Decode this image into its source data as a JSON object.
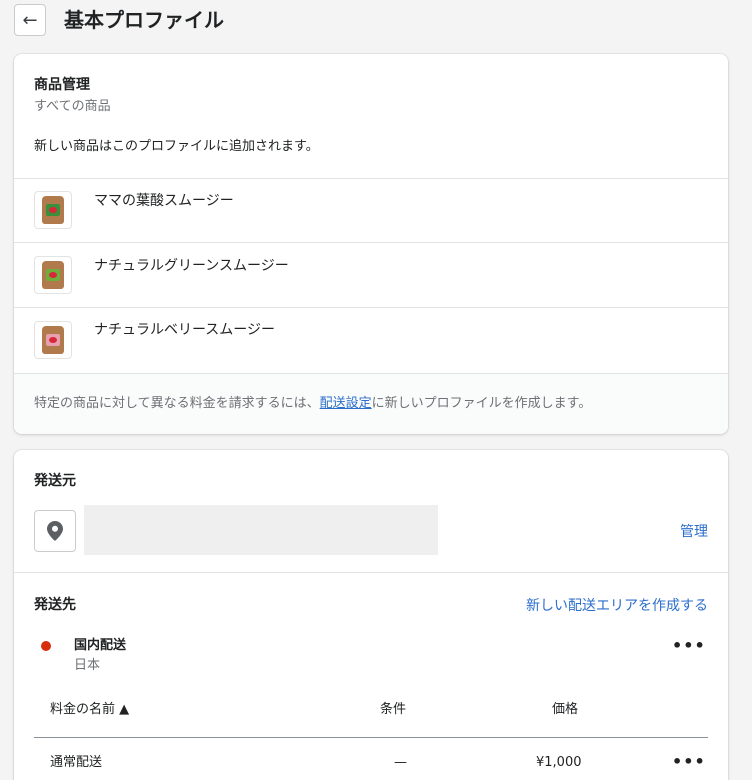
{
  "header": {
    "back_label": "←",
    "title": "基本プロファイル"
  },
  "products_card": {
    "title": "商品管理",
    "subtitle": "すべての商品",
    "note": "新しい商品はこのプロファイルに追加されます。",
    "products": [
      {
        "name": "ママの葉酸スムージー",
        "label_color": "#3b8f3b"
      },
      {
        "name": "ナチュラルグリーンスムージー",
        "label_color": "#6fae3a"
      },
      {
        "name": "ナチュラルベリースムージー",
        "label_color": "#e8a0b0"
      }
    ],
    "footer_before": "特定の商品に対して異なる料金を請求するには、",
    "footer_link": "配送設定",
    "footer_after": "に新しいプロファイルを作成します。"
  },
  "shipping_card": {
    "origin_title": "発送元",
    "manage_link": "管理",
    "dest_title": "発送先",
    "create_zone_link": "新しい配送エリアを作成する",
    "zone": {
      "name": "国内配送",
      "country": "日本",
      "more": "•••"
    },
    "table": {
      "headers": {
        "name": "料金の名前 ▲",
        "condition": "条件",
        "price": "価格"
      },
      "rows": [
        {
          "name": "通常配送",
          "condition": "—",
          "price": "¥1,000",
          "more": "•••"
        }
      ]
    }
  },
  "colors": {
    "accent_link": "#2c6ecb",
    "zone_dot": "#d72c0d",
    "background": "#f4f4f4"
  }
}
